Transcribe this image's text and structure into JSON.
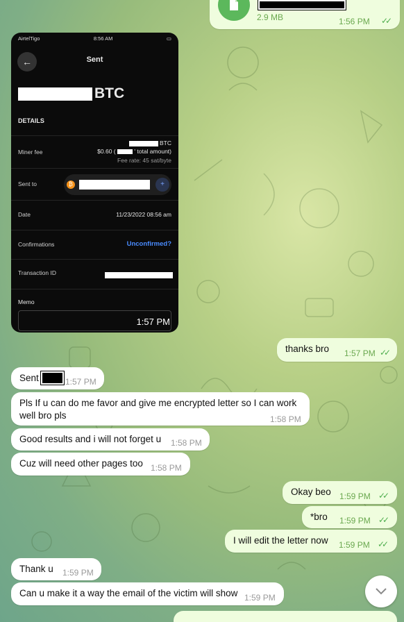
{
  "file_msg": {
    "size": "2.9 MB",
    "time": "1:56 PM"
  },
  "screenshot": {
    "carrier": "AirtelTigo",
    "clock": "8:56 AM",
    "title": "Sent",
    "amount_unit": "BTC",
    "details_label": "DETAILS",
    "miner_fee_label": "Miner fee",
    "fee_btc_unit": "BTC",
    "fee_usd": "$0.60 (",
    "fee_total": "' total amount)",
    "fee_rate": "Fee rate: 45 sat/byte",
    "sent_to_label": "Sent to",
    "date_label": "Date",
    "date_value": "11/23/2022 08:56 am",
    "confirmations_label": "Confirmations",
    "confirmations_value": "Unconfirmed?",
    "txid_label": "Transaction ID",
    "memo_label": "Memo",
    "time": "1:57 PM"
  },
  "messages": [
    {
      "dir": "out",
      "text": "thanks bro",
      "time": "1:57 PM"
    },
    {
      "dir": "in",
      "text": "Sent",
      "time": "1:57 PM"
    },
    {
      "dir": "in",
      "text": "Pls If u can do me favor and give me encrypted letter so I can work well bro pls",
      "time": "1:58 PM"
    },
    {
      "dir": "in",
      "text": "Good results and i will not forget u",
      "time": "1:58 PM"
    },
    {
      "dir": "in",
      "text": "Cuz will need other pages too",
      "time": "1:58 PM"
    },
    {
      "dir": "out",
      "text": "Okay beo",
      "time": "1:59 PM"
    },
    {
      "dir": "out",
      "text": "*bro",
      "time": "1:59 PM"
    },
    {
      "dir": "out",
      "text": "I will edit the letter now",
      "time": "1:59 PM"
    },
    {
      "dir": "in",
      "text": "Thank u",
      "time": "1:59 PM"
    },
    {
      "dir": "in",
      "text": "Can u make it a way the email of the victim will show",
      "time": "1:59 PM"
    }
  ],
  "colors": {
    "incoming": "#ffffff",
    "outgoing": "#effdde",
    "accent": "#4fae4e",
    "link": "#4a8cff"
  },
  "icons": [
    "file-icon",
    "double-check-icon",
    "back-arrow-icon",
    "bitcoin-icon",
    "add-contact-icon",
    "chevron-down-icon"
  ]
}
